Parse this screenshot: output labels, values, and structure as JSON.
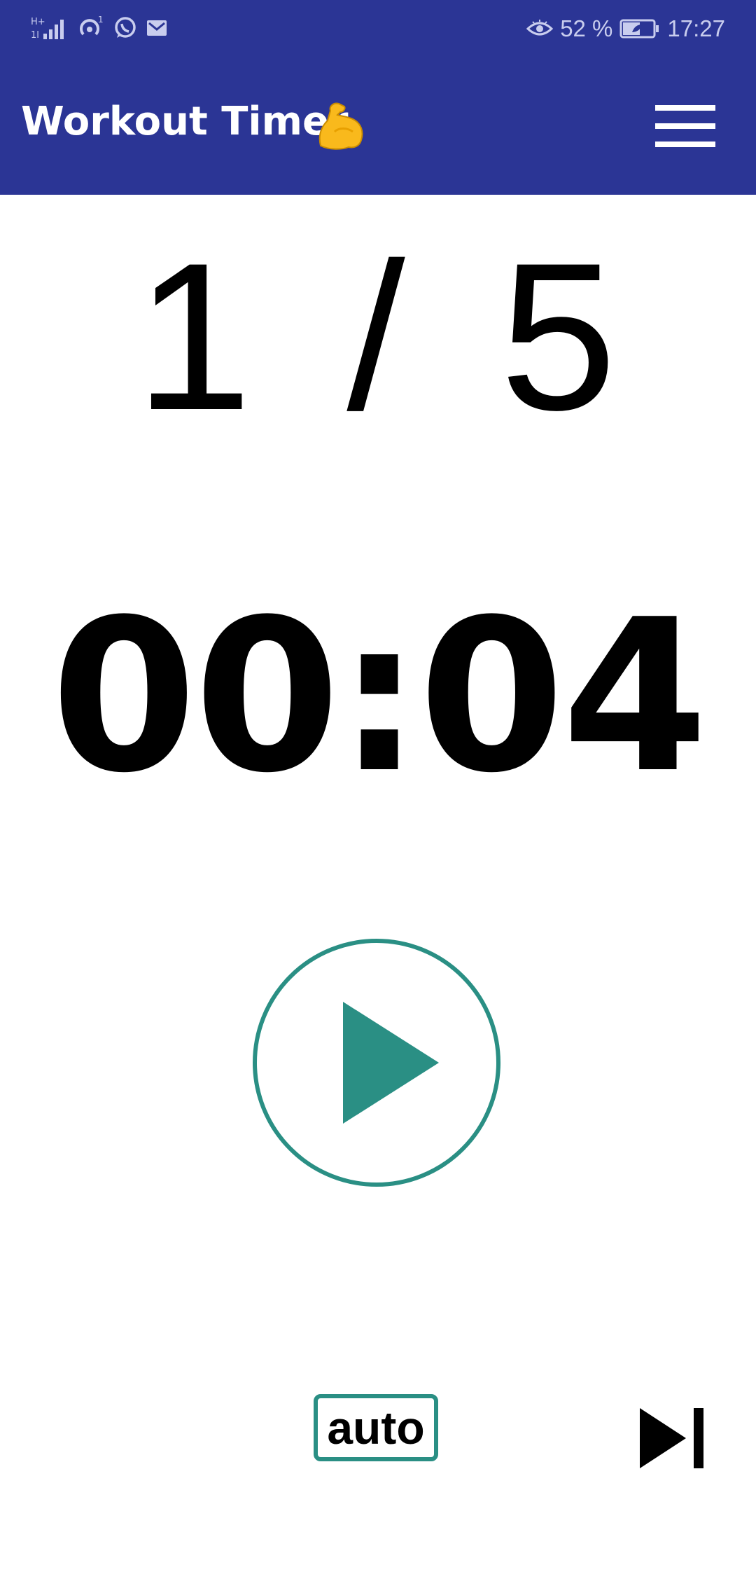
{
  "status_bar": {
    "icons_left": [
      "network-signal-icon",
      "hotspot-icon",
      "whatsapp-icon",
      "mail-icon"
    ],
    "notification_count": "1",
    "icons_right": [
      "eye-comfort-icon",
      "battery-icon"
    ],
    "battery": "52 %",
    "time": "17:27"
  },
  "header": {
    "title": "Workout Timer",
    "title_icon": "flexed-biceps-icon",
    "menu_icon": "hamburger-menu-icon",
    "background_color": "#2b3595"
  },
  "main": {
    "round_counter": "1 / 5",
    "timer": "00:04",
    "play_icon": "play-icon",
    "auto_label": "auto",
    "skip_icon": "skip-next-icon",
    "accent_color": "#2a8f84"
  }
}
